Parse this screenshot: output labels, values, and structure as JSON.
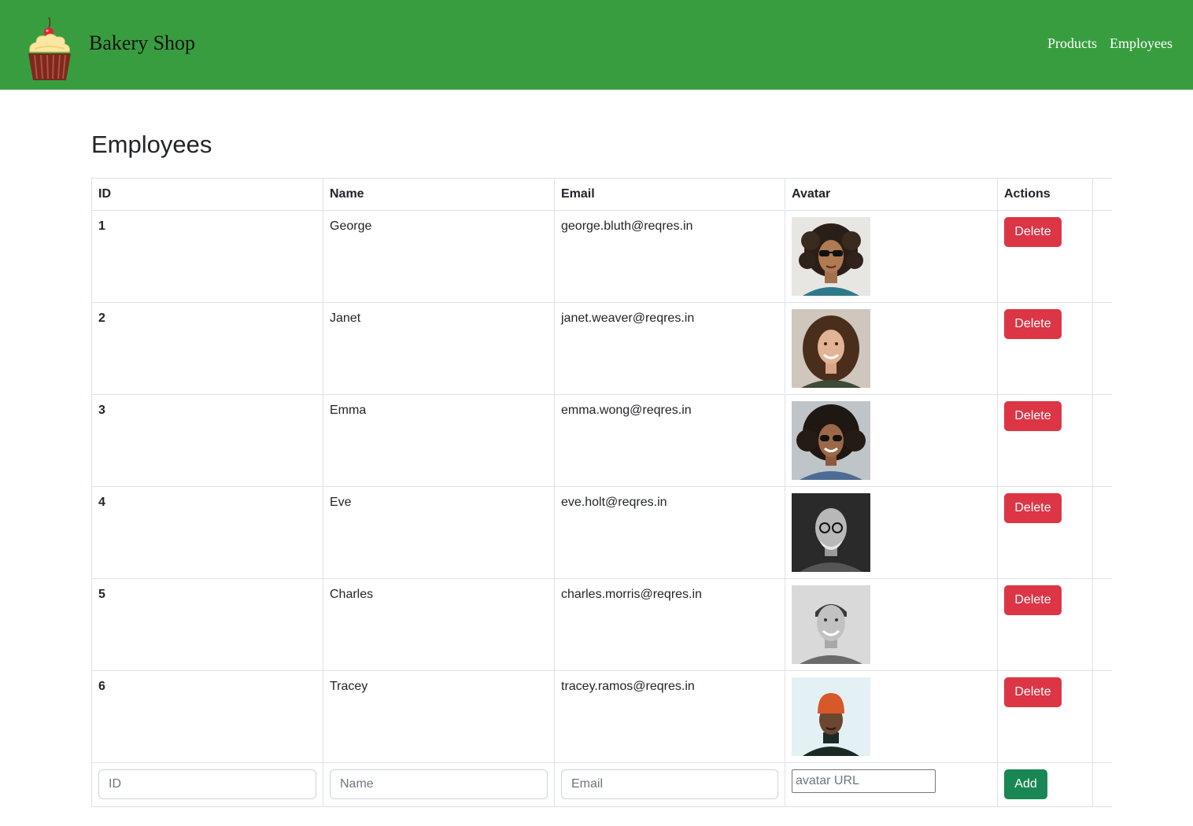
{
  "brand": {
    "name": "Bakery Shop",
    "logo_icon": "cupcake-icon"
  },
  "nav": {
    "products": "Products",
    "employees": "Employees"
  },
  "colors": {
    "navbar": "#389d3f",
    "delete": "#dc3545",
    "add": "#198754"
  },
  "page": {
    "title": "Employees"
  },
  "table": {
    "headers": {
      "id": "ID",
      "name": "Name",
      "email": "Email",
      "avatar": "Avatar",
      "actions": "Actions"
    },
    "rows": [
      {
        "id": "1",
        "name": "George",
        "email": "george.bluth@reqres.in",
        "delete": "Delete"
      },
      {
        "id": "2",
        "name": "Janet",
        "email": "janet.weaver@reqres.in",
        "delete": "Delete"
      },
      {
        "id": "3",
        "name": "Emma",
        "email": "emma.wong@reqres.in",
        "delete": "Delete"
      },
      {
        "id": "4",
        "name": "Eve",
        "email": "eve.holt@reqres.in",
        "delete": "Delete"
      },
      {
        "id": "5",
        "name": "Charles",
        "email": "charles.morris@reqres.in",
        "delete": "Delete"
      },
      {
        "id": "6",
        "name": "Tracey",
        "email": "tracey.ramos@reqres.in",
        "delete": "Delete"
      }
    ]
  },
  "form": {
    "id_placeholder": "ID",
    "name_placeholder": "Name",
    "email_placeholder": "Email",
    "avatar_placeholder": "avatar URL",
    "add_label": "Add"
  }
}
